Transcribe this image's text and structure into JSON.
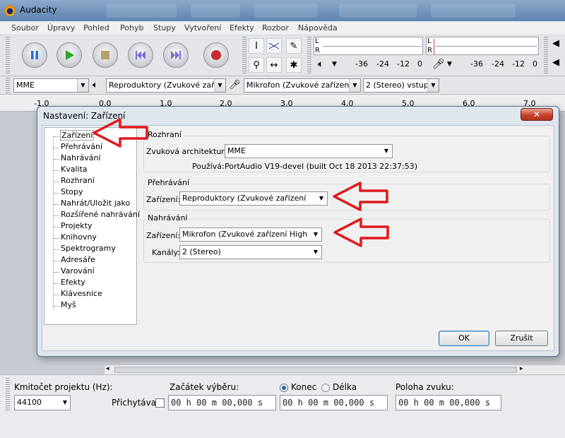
{
  "app": {
    "title": "Audacity"
  },
  "menu": [
    "Soubor",
    "Úpravy",
    "Pohled",
    "Pohyb",
    "Stupy",
    "Vytvoření",
    "Efekty",
    "Rozbor",
    "Nápověda"
  ],
  "meters": {
    "play_l": "L",
    "play_r": "R",
    "rec_l": "L",
    "rec_r": "R",
    "scale_left": [
      "-36",
      "-24",
      "-12",
      "0"
    ],
    "scale_right": [
      "-36",
      "-24",
      "-12",
      "0"
    ]
  },
  "devicebar": {
    "host": "MME",
    "output": "Reproduktory (Zvukové zaříze",
    "input": "Mikrofon (Zvukové zařízení Hig",
    "channels": "2 (Stereo) vstupn"
  },
  "ruler": [
    "-1,0",
    "0,0",
    "1,0",
    "2,0",
    "3,0",
    "4,0",
    "5,0",
    "6,0",
    "7,0"
  ],
  "dialog": {
    "title": "Nastavení: Zařízení",
    "close": "✕",
    "tree": [
      "Zařízení",
      "Přehrávání",
      "Nahrávání",
      "Kvalita",
      "Rozhraní",
      "Stopy",
      "Nahrát/Uložit jako",
      "Rozšířené nahrávání",
      "Projekty",
      "Knihovny",
      "Spektrogramy",
      "Adresáře",
      "Varování",
      "Efekty",
      "Klávesnice",
      "Myš"
    ],
    "interface": {
      "group": "Rozhraní",
      "arch_label": "Zvuková architektura:",
      "arch_value": "MME",
      "uses_label": "Používá:",
      "uses_value": "PortAudio V19-devel (built Oct 18 2013 22:37:53)"
    },
    "playback": {
      "group": "Přehrávání",
      "device_label": "Zařízení:",
      "device_value": "Reproduktory (Zvukové zařízení"
    },
    "recording": {
      "group": "Nahrávání",
      "device_label": "Zařízení:",
      "device_value": "Mikrofon (Zvukové zařízení High",
      "channels_label": "Kanály:",
      "channels_value": "2 (Stereo)"
    },
    "ok": "OK",
    "cancel": "Zrušit"
  },
  "selection": {
    "rate_label": "Kmitočet projektu (Hz):",
    "rate_value": "44100",
    "snap_label": "Přichytávat",
    "start_label": "Začátek výběru:",
    "end_label": "Konec",
    "length_label": "Délka",
    "pos_label": "Poloha zvuku:",
    "start_value": "00 h 00 m 00,000 s",
    "end_value": "00 h 00 m 00,000 s",
    "pos_value": "00 h 00 m 00,000 s"
  }
}
